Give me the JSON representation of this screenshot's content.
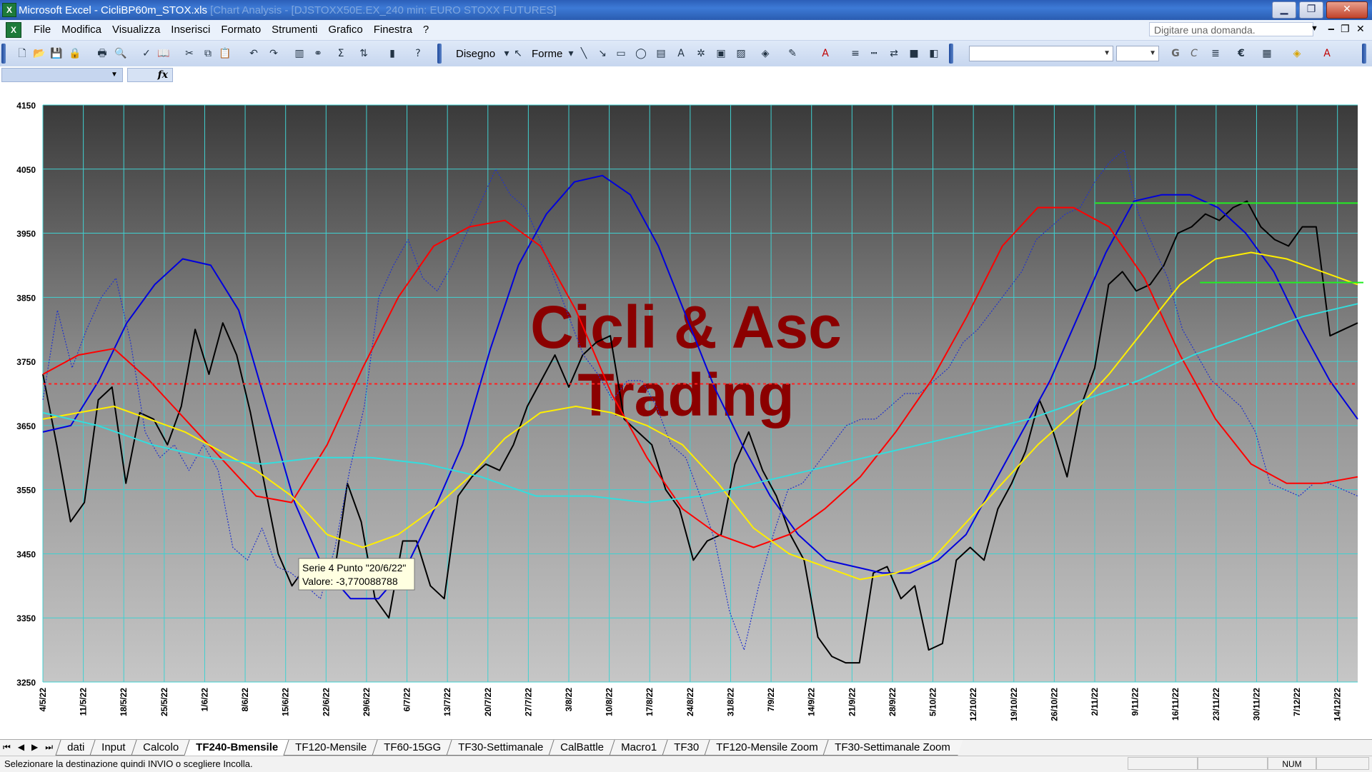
{
  "window": {
    "app_name": "Microsoft Excel",
    "file_name": "CicliBP60m_STOX.xls",
    "faded_title": "[Chart Analysis - [DJSTOXX50E.EX_240 min: EURO STOXX FUTURES]",
    "minimize": "▁",
    "restore": "❐",
    "close": "✕"
  },
  "menu": {
    "items": [
      "File",
      "Modifica",
      "Visualizza",
      "Inserisci",
      "Formato",
      "Strumenti",
      "Grafico",
      "Finestra",
      "?"
    ],
    "help_placeholder": "Digitare una domanda.",
    "doc_minimize": "‒",
    "doc_restore": "❐",
    "doc_close": "✕"
  },
  "toolbar": {
    "disegno_label": "Disegno",
    "forme_label": "Forme",
    "icons": [
      "new-icon",
      "open-icon",
      "save-icon",
      "permission-icon",
      "print-icon",
      "print-preview-icon",
      "spelling-icon",
      "research-icon",
      "cut-icon",
      "copy-icon",
      "paste-icon",
      "undo-icon",
      "redo-icon",
      "chart-wizard-icon",
      "insert-hyperlink-icon",
      "autosum-icon",
      "sort-icon",
      "chart-icon",
      "help-icon"
    ]
  },
  "chart_data": {
    "type": "line",
    "watermark": [
      "Cicli & Asc",
      "Trading"
    ],
    "ylim": [
      3250,
      4150
    ],
    "y_ticks": [
      3250,
      3350,
      3450,
      3550,
      3650,
      3750,
      3850,
      3950,
      4050,
      4150
    ],
    "x_ticks": [
      "4/5/22",
      "11/5/22",
      "18/5/22",
      "25/5/22",
      "1/6/22",
      "8/6/22",
      "15/6/22",
      "22/6/22",
      "29/6/22",
      "6/7/22",
      "13/7/22",
      "20/7/22",
      "27/7/22",
      "3/8/22",
      "10/8/22",
      "17/8/22",
      "24/8/22",
      "31/8/22",
      "7/9/22",
      "14/9/22",
      "21/9/22",
      "28/9/22",
      "5/10/22",
      "12/10/22",
      "19/10/22",
      "26/10/22",
      "2/11/22",
      "9/11/22",
      "16/11/22",
      "23/11/22",
      "30/11/22",
      "7/12/22",
      "14/12/22"
    ],
    "grid": true,
    "series": [
      {
        "color": "#000000",
        "style": "solid",
        "values": [
          3730,
          3620,
          3500,
          3530,
          3690,
          3710,
          3560,
          3670,
          3660,
          3620,
          3680,
          3800,
          3730,
          3810,
          3760,
          3670,
          3560,
          3450,
          3400,
          3430,
          3440,
          3410,
          3560,
          3500,
          3380,
          3350,
          3470,
          3470,
          3400,
          3380,
          3540,
          3570,
          3590,
          3580,
          3620,
          3680,
          3720,
          3760,
          3710,
          3760,
          3780,
          3790,
          3660,
          3640,
          3620,
          3550,
          3520,
          3440,
          3470,
          3480,
          3590,
          3640,
          3580,
          3540,
          3480,
          3440,
          3320,
          3290,
          3280,
          3280,
          3420,
          3430,
          3380,
          3400,
          3300,
          3310,
          3440,
          3460,
          3440,
          3520,
          3560,
          3610,
          3690,
          3640,
          3570,
          3680,
          3740,
          3870,
          3890,
          3860,
          3870,
          3900,
          3950,
          3960,
          3980,
          3970,
          3990,
          4000,
          3960,
          3940,
          3930,
          3960,
          3960,
          3790,
          3800,
          3810
        ]
      },
      {
        "color": "#2233cc",
        "style": "dotted",
        "values": [
          3690,
          3830,
          3740,
          3800,
          3850,
          3880,
          3780,
          3640,
          3600,
          3620,
          3580,
          3620,
          3580,
          3460,
          3440,
          3490,
          3430,
          3420,
          3400,
          3380,
          3460,
          3580,
          3680,
          3850,
          3900,
          3940,
          3880,
          3860,
          3900,
          3950,
          4000,
          4050,
          4010,
          3990,
          3940,
          3880,
          3820,
          3760,
          3730,
          3690,
          3720,
          3720,
          3680,
          3620,
          3600,
          3540,
          3470,
          3360,
          3300,
          3400,
          3480,
          3550,
          3560,
          3590,
          3620,
          3650,
          3660,
          3660,
          3680,
          3700,
          3700,
          3720,
          3740,
          3780,
          3800,
          3830,
          3860,
          3890,
          3940,
          3960,
          3980,
          3990,
          4030,
          4060,
          4080,
          3980,
          3930,
          3880,
          3800,
          3760,
          3720,
          3700,
          3680,
          3640,
          3560,
          3550,
          3540,
          3560,
          3560,
          3550,
          3540
        ]
      },
      {
        "color": "#0000dd",
        "style": "solid",
        "values": [
          3640,
          3650,
          3720,
          3810,
          3870,
          3910,
          3900,
          3830,
          3680,
          3530,
          3430,
          3380,
          3380,
          3430,
          3520,
          3620,
          3770,
          3900,
          3980,
          4030,
          4040,
          4010,
          3930,
          3820,
          3710,
          3620,
          3540,
          3480,
          3440,
          3430,
          3420,
          3420,
          3440,
          3480,
          3560,
          3640,
          3720,
          3820,
          3920,
          4000,
          4010,
          4010,
          3990,
          3950,
          3890,
          3800,
          3720,
          3660
        ]
      },
      {
        "color": "#ff0000",
        "style": "solid",
        "values": [
          3730,
          3760,
          3770,
          3720,
          3660,
          3600,
          3540,
          3530,
          3620,
          3740,
          3850,
          3930,
          3960,
          3970,
          3930,
          3830,
          3700,
          3600,
          3520,
          3480,
          3460,
          3480,
          3520,
          3570,
          3640,
          3720,
          3820,
          3930,
          3990,
          3990,
          3960,
          3880,
          3760,
          3660,
          3590,
          3560,
          3560,
          3570
        ]
      },
      {
        "color": "#ffee00",
        "style": "solid",
        "values": [
          3660,
          3670,
          3680,
          3660,
          3640,
          3610,
          3580,
          3540,
          3480,
          3460,
          3480,
          3520,
          3570,
          3630,
          3670,
          3680,
          3670,
          3650,
          3620,
          3560,
          3490,
          3450,
          3430,
          3410,
          3420,
          3440,
          3500,
          3560,
          3620,
          3670,
          3730,
          3800,
          3870,
          3910,
          3920,
          3910,
          3890,
          3870
        ]
      },
      {
        "color": "#33dddd",
        "style": "solid",
        "values": [
          3670,
          3650,
          3620,
          3600,
          3590,
          3600,
          3600,
          3590,
          3570,
          3540,
          3540,
          3530,
          3540,
          3560,
          3580,
          3600,
          3620,
          3640,
          3660,
          3690,
          3720,
          3760,
          3790,
          3820,
          3840
        ]
      }
    ],
    "red_dotted_level": 3715,
    "green_levels": [
      {
        "y": 3997,
        "from": "2/11/22",
        "to": "end"
      },
      {
        "y": 3873,
        "from": "20/11/22",
        "to": "end"
      }
    ],
    "tooltip": {
      "line1": "Serie 4 Punto \"20/6/22\"",
      "line2": "Valore: -3,770088788"
    }
  },
  "tabs": {
    "nav": [
      "⏮",
      "◀",
      "▶",
      "⏭"
    ],
    "items": [
      "dati",
      "Input",
      "Calcolo",
      "TF240-Bmensile",
      "TF120-Mensile",
      "TF60-15GG",
      "TF30-Settimanale",
      "CalBattle",
      "Macro1",
      "TF30",
      "TF120-Mensile Zoom",
      "TF30-Settimanale Zoom"
    ],
    "active": "TF240-Bmensile"
  },
  "status": {
    "message": "Selezionare la destinazione quindi INVIO o scegliere Incolla.",
    "num": "NUM"
  }
}
